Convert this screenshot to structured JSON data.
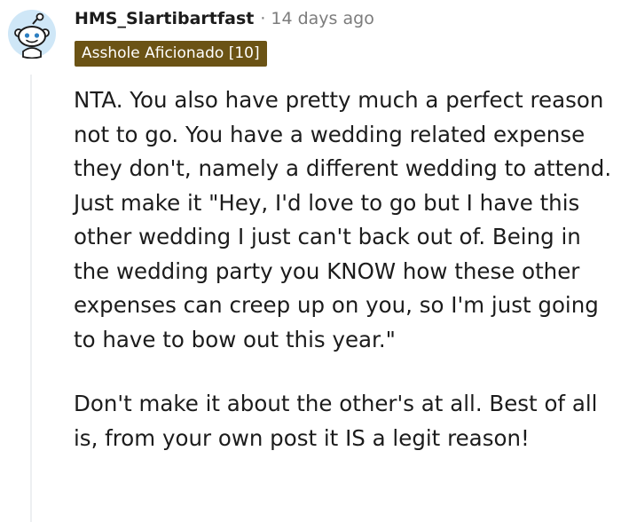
{
  "comment": {
    "username": "HMS_Slartibartfast",
    "separator": "·",
    "timestamp": "14 days ago",
    "flair": "Asshole Aficionado [10]",
    "paragraphs": [
      "NTA. You also have pretty much a perfect reason not to go. You have a wedding related expense they don't, namely a different wedding to attend. Just make it \"Hey, I'd love to go but I have this other wedding I just can't back out of. Being in the wedding party you KNOW how these other expenses can creep up on you, so I'm just going to have to bow out this year.\"",
      "Don't make it about the other's at all. Best of all is, from your own post it IS a legit reason!"
    ]
  },
  "icons": {
    "avatar": "reddit-snoo-avatar-icon"
  },
  "colors": {
    "flair_background": "#6b5315",
    "flair_text": "#ffffff",
    "avatar_ring": "#cfe7f7",
    "meta_text": "#7c7c7c",
    "body_text": "#1c1c1c",
    "thread_line": "#edeff1"
  }
}
